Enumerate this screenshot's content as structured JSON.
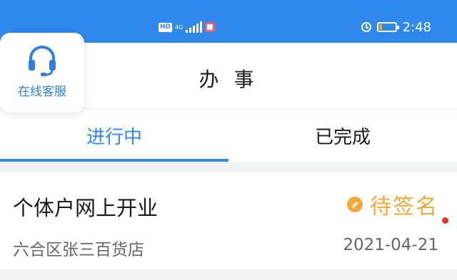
{
  "status_bar": {
    "hd": "HD",
    "network": "4G",
    "time": "2:48",
    "battery_level": 0.2,
    "colors": {
      "background": "#2f88ec",
      "battery_fill": "#f5a524"
    },
    "icons": [
      "hd-icon",
      "signal-icon",
      "app-notification-icon",
      "alarm-icon",
      "battery-icon"
    ]
  },
  "header": {
    "title": "办 事",
    "service": {
      "label": "在线客服",
      "icon": "headset-icon"
    }
  },
  "tabs": [
    {
      "label": "进行中",
      "active": true
    },
    {
      "label": "已完成",
      "active": false
    }
  ],
  "items": [
    {
      "title": "个体户网上开业",
      "subtitle": "六合区张三百货店",
      "status": "待签名",
      "status_icon": "pen-icon",
      "date": "2021-04-21",
      "unread_dot": true
    }
  ],
  "colors": {
    "accent": "#2f88ec",
    "status": "#f0a93a",
    "dot": "#d93a2b"
  }
}
